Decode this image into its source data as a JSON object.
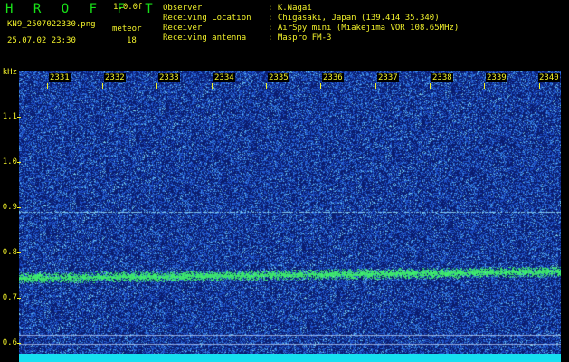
{
  "header": {
    "app_title": "H R O F F T",
    "version": "1.0.0f",
    "filename": "KN9_2507022330.png",
    "mode": "meteor",
    "timestamp": "25.07.02 23:30",
    "count": "18",
    "observer_label": "Observer",
    "observer_value": ": K.Nagai",
    "location_label": "Receiving Location",
    "location_value": ": Chigasaki, Japan (139.414 35.340)",
    "receiver_label": "Receiver",
    "receiver_value": ": AirSpy mini (Miakejima VOR 108.65MHz)",
    "antenna_label": "Receiving antenna",
    "antenna_value": ": Maspro FM-3"
  },
  "plot": {
    "y_unit": "kHz",
    "y_ticks": [
      "1.1",
      "1.0",
      "0.9",
      "0.8",
      "0.7",
      "0.6"
    ],
    "x_ticks": [
      "2331",
      "2332",
      "2333",
      "2334",
      "2335",
      "2336",
      "2337",
      "2338",
      "2339",
      "2340"
    ],
    "colors": {
      "background": "#0a1c6e",
      "noise": "#2a63d8",
      "signal": "#3cf07a",
      "label": "#f2f22a",
      "title": "#18e218"
    }
  }
}
